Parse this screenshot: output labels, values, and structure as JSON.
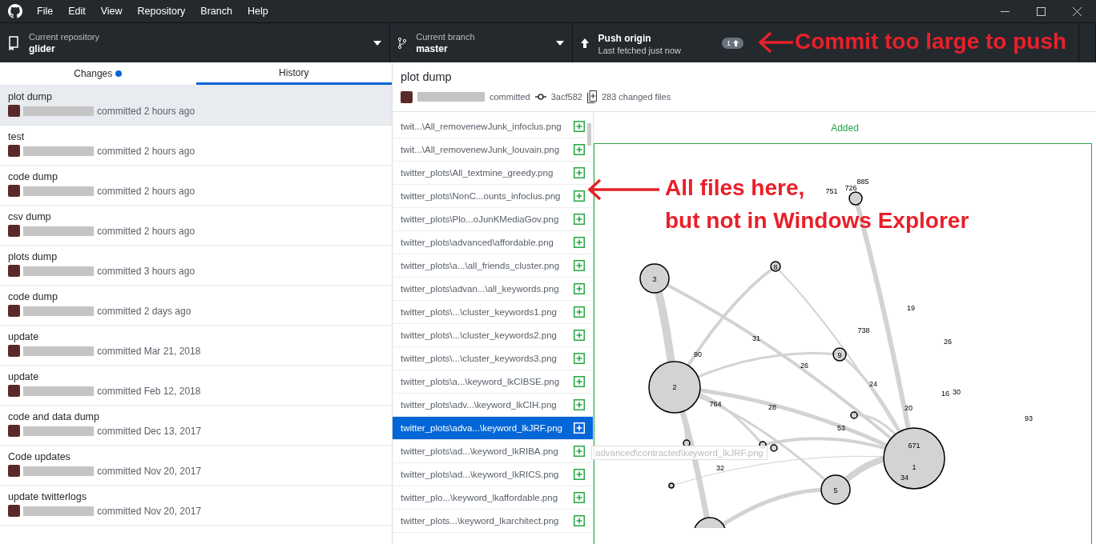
{
  "menu": [
    "File",
    "Edit",
    "View",
    "Repository",
    "Branch",
    "Help"
  ],
  "toolbar": {
    "repository": {
      "label": "Current repository",
      "value": "glider"
    },
    "branch": {
      "label": "Current branch",
      "value": "master"
    },
    "push": {
      "label": "Push origin",
      "sub": "Last fetched just now",
      "count": "1"
    }
  },
  "tabs": [
    {
      "label": "Changes",
      "selected": false,
      "has_changes": true
    },
    {
      "label": "History",
      "selected": true,
      "has_changes": false
    }
  ],
  "commits": [
    {
      "title": "plot dump",
      "time": "committed 2 hours ago",
      "selected": true
    },
    {
      "title": "test",
      "time": "committed 2 hours ago",
      "selected": false
    },
    {
      "title": "code dump",
      "time": "committed 2 hours ago",
      "selected": false
    },
    {
      "title": "csv dump",
      "time": "committed 2 hours ago",
      "selected": false
    },
    {
      "title": "plots dump",
      "time": "committed 3 hours ago",
      "selected": false
    },
    {
      "title": "code dump",
      "time": "committed 2 days ago",
      "selected": false
    },
    {
      "title": "update",
      "time": "committed Mar 21, 2018",
      "selected": false
    },
    {
      "title": "update",
      "time": "committed Feb 12, 2018",
      "selected": false
    },
    {
      "title": "code and data dump",
      "time": "committed Dec 13, 2017",
      "selected": false
    },
    {
      "title": "Code updates",
      "time": "committed Nov 20, 2017",
      "selected": false
    },
    {
      "title": "update twitterlogs",
      "time": "committed Nov 20, 2017",
      "selected": false
    }
  ],
  "commit_detail": {
    "title": "plot dump",
    "committed": "committed",
    "sha": "3acf582",
    "changed": "283 changed files"
  },
  "files": [
    {
      "path": "twit...\\All_removenewJunk_infoclus.png",
      "selected": false
    },
    {
      "path": "twit...\\All_removenewJunk_louvain.png",
      "selected": false
    },
    {
      "path": "twitter_plots\\All_textmine_greedy.png",
      "selected": false
    },
    {
      "path": "twitter_plots\\NonC...ounts_infoclus.png",
      "selected": false
    },
    {
      "path": "twitter_plots\\Plo...oJunKMediaGov.png",
      "selected": false
    },
    {
      "path": "twitter_plots\\advanced\\affordable.png",
      "selected": false
    },
    {
      "path": "twitter_plots\\a...\\all_friends_cluster.png",
      "selected": false
    },
    {
      "path": "twitter_plots\\advan...\\all_keywords.png",
      "selected": false
    },
    {
      "path": "twitter_plots\\...\\cluster_keywords1.png",
      "selected": false
    },
    {
      "path": "twitter_plots\\...\\cluster_keywords2.png",
      "selected": false
    },
    {
      "path": "twitter_plots\\...\\cluster_keywords3.png",
      "selected": false
    },
    {
      "path": "twitter_plots\\a...\\keyword_lkCIBSE.png",
      "selected": false
    },
    {
      "path": "twitter_plots\\adv...\\keyword_lkCIH.png",
      "selected": false
    },
    {
      "path": "twitter_plots\\adva...\\keyword_lkJRF.png",
      "selected": true
    },
    {
      "path": "twitter_plots\\ad...\\keyword_lkRIBA.png",
      "selected": false
    },
    {
      "path": "twitter_plots\\ad...\\keyword_lkRICS.png",
      "selected": false
    },
    {
      "path": "twitter_plo...\\keyword_lkaffordable.png",
      "selected": false
    },
    {
      "path": "twitter_plots...\\keyword_lkarchitect.png",
      "selected": false
    }
  ],
  "tooltip": "advanced\\contracted\\keyword_lkJRF.png",
  "diff": {
    "status": "Added",
    "graph_labels": [
      "2",
      "3",
      "671",
      "1",
      "34",
      "5",
      "8",
      "9",
      "885",
      "726",
      "751",
      "19",
      "26",
      "31",
      "90",
      "26",
      "764",
      "28",
      "53",
      "24",
      "20",
      "16",
      "30",
      "93",
      "32",
      "738"
    ]
  },
  "annotations": [
    {
      "text": "Commit too large to push"
    },
    {
      "text": "All files here,"
    },
    {
      "text": "but not in Windows Explorer"
    }
  ]
}
